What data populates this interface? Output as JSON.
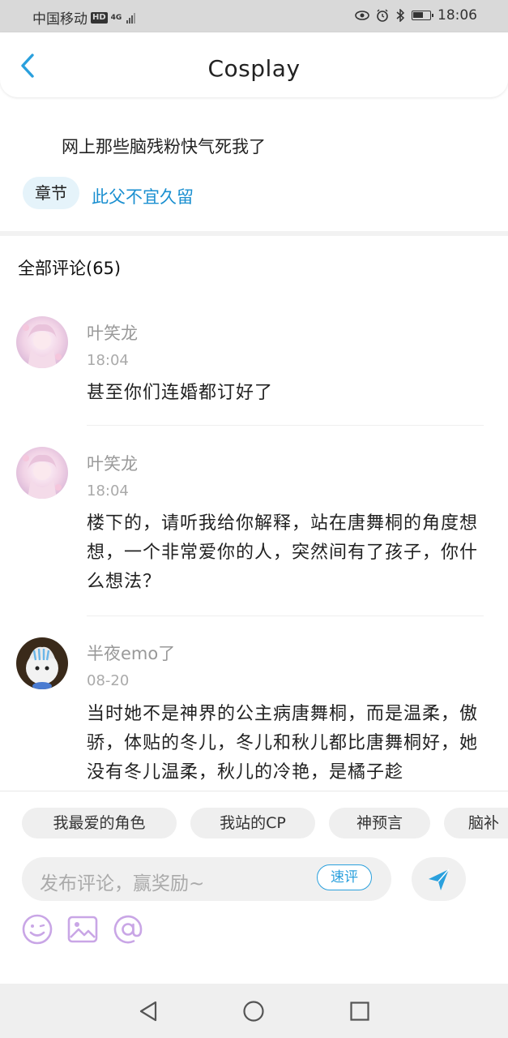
{
  "status_bar": {
    "carrier": "中国移动",
    "hd": "HD",
    "network": "4G",
    "time": "18:06"
  },
  "header": {
    "title": "Cosplay",
    "back_icon": "chevron-left-icon"
  },
  "post": {
    "text": "网上那些脑残粉快气死我了",
    "chapter_badge": "章节",
    "chapter_link": "此父不宜久留"
  },
  "comments_section": {
    "title": "全部评论(65)",
    "items": [
      {
        "name": "叶笑龙",
        "time": "18:04",
        "text": "甚至你们连婚都订好了"
      },
      {
        "name": "叶笑龙",
        "time": "18:04",
        "text": "楼下的，请听我给你解释，站在唐舞桐的角度想想，一个非常爱你的人，突然间有了孩子，你什么想法？"
      },
      {
        "name": "半夜emo了",
        "time": "08-20",
        "text": "当时她不是神界的公主病唐舞桐，而是温柔，傲骄，体贴的冬儿，冬儿和秋儿都比唐舞桐好，她没有冬儿温柔，秋儿的冷艳，是橘子趁"
      }
    ]
  },
  "composer": {
    "quick_tags": [
      "我最爱的角色",
      "我站的CP",
      "神预言",
      "脑补"
    ],
    "placeholder": "发布评论，赢奖励~",
    "quick_review": "速评",
    "tools": [
      "emoji-icon",
      "image-icon",
      "mention-icon"
    ]
  },
  "colors": {
    "accent": "#1a8fd0",
    "tool_icon": "#c9a6e6",
    "send": "#2aa0dd"
  }
}
